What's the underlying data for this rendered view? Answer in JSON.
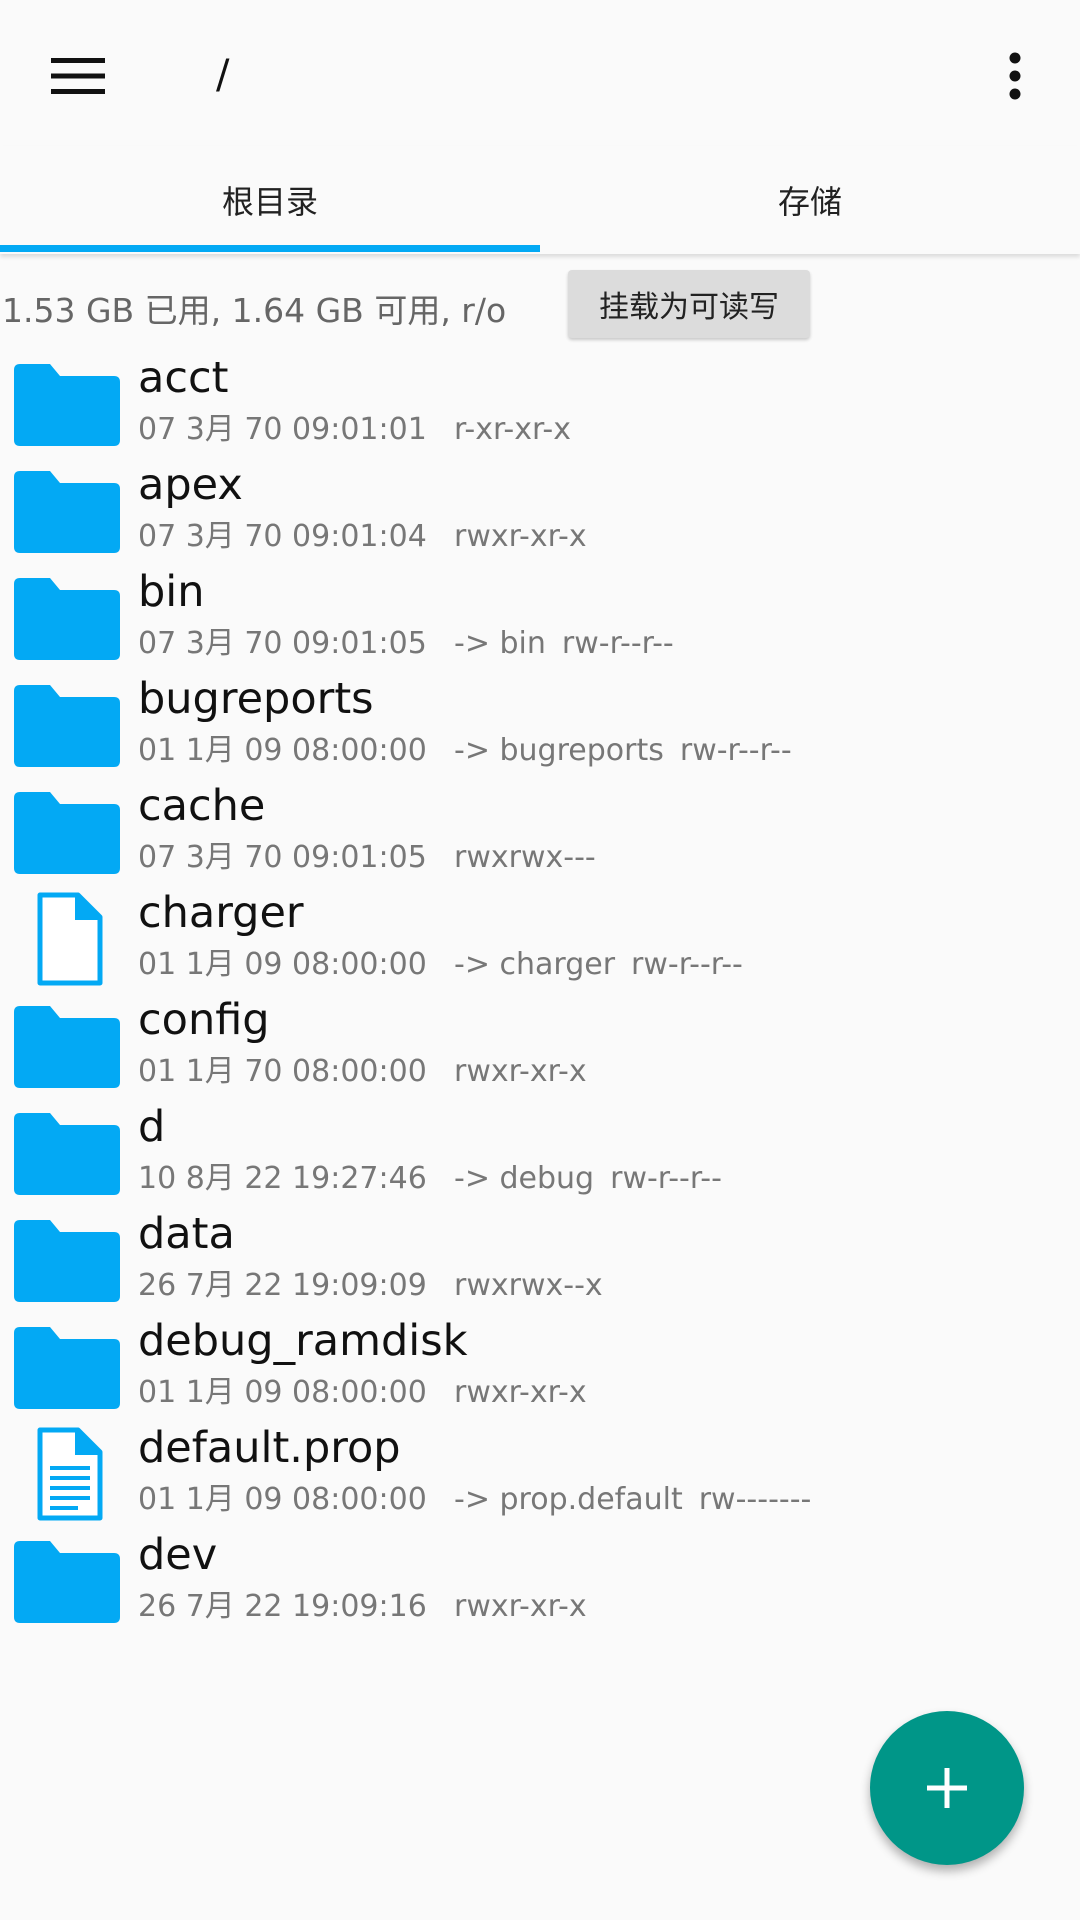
{
  "header": {
    "path": "/"
  },
  "tabs": [
    {
      "label": "根目录",
      "active": true
    },
    {
      "label": "存储",
      "active": false
    }
  ],
  "storage": {
    "info": "1.53 GB 已用, 1.64 GB 可用, r/o",
    "mount_button": "挂载为可读写"
  },
  "files": [
    {
      "name": "acct",
      "date": "07 3月 70 09:01:01",
      "target": "",
      "perms": "r-xr-xr-x",
      "type": "folder"
    },
    {
      "name": "apex",
      "date": "07 3月 70 09:01:04",
      "target": "",
      "perms": "rwxr-xr-x",
      "type": "folder"
    },
    {
      "name": "bin",
      "date": "07 3月 70 09:01:05",
      "target": "-> bin",
      "perms": "rw-r--r--",
      "type": "folder"
    },
    {
      "name": "bugreports",
      "date": "01 1月 09 08:00:00",
      "target": "-> bugreports",
      "perms": "rw-r--r--",
      "type": "folder"
    },
    {
      "name": "cache",
      "date": "07 3月 70 09:01:05",
      "target": "",
      "perms": "rwxrwx---",
      "type": "folder"
    },
    {
      "name": "charger",
      "date": "01 1月 09 08:00:00",
      "target": "-> charger",
      "perms": "rw-r--r--",
      "type": "file"
    },
    {
      "name": "config",
      "date": "01 1月 70 08:00:00",
      "target": "",
      "perms": "rwxr-xr-x",
      "type": "folder"
    },
    {
      "name": "d",
      "date": "10 8月 22 19:27:46",
      "target": "-> debug",
      "perms": "rw-r--r--",
      "type": "folder"
    },
    {
      "name": "data",
      "date": "26 7月 22 19:09:09",
      "target": "",
      "perms": "rwxrwx--x",
      "type": "folder"
    },
    {
      "name": "debug_ramdisk",
      "date": "01 1月 09 08:00:00",
      "target": "",
      "perms": "rwxr-xr-x",
      "type": "folder"
    },
    {
      "name": "default.prop",
      "date": "01 1月 09 08:00:00",
      "target": "-> prop.default",
      "perms": "rw-------",
      "type": "text-file"
    },
    {
      "name": "dev",
      "date": "26 7月 22 19:09:16",
      "target": "",
      "perms": "rwxr-xr-x",
      "type": "folder"
    }
  ],
  "colors": {
    "accent": "#03a9f4",
    "folder": "#03a9f4",
    "fab": "#009688"
  }
}
